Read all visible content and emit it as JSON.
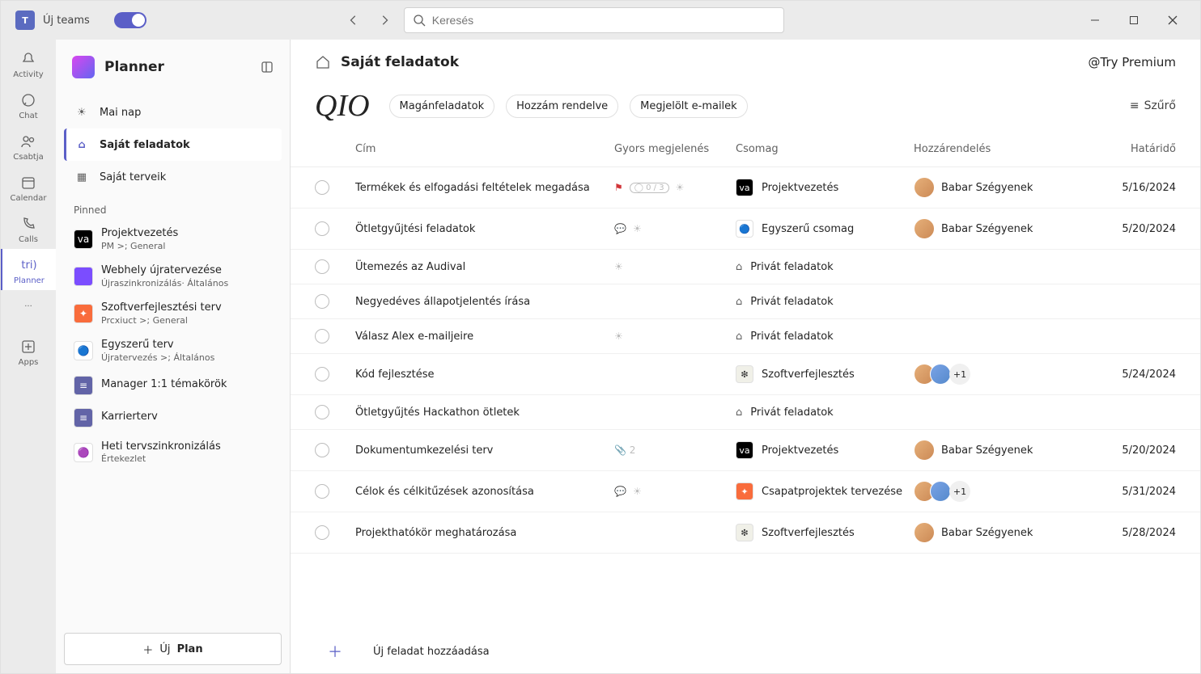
{
  "titlebar": {
    "app_label": "Új teams",
    "logo_initials": "T"
  },
  "search": {
    "placeholder": "Keresés"
  },
  "rail": {
    "activity": "Activity",
    "chat": "Chat",
    "csabtja": "Csabtja",
    "calendar": "Calendar",
    "calls": "Calls",
    "planner_short": "tri)",
    "planner": "Planner",
    "apps": "Apps"
  },
  "panel": {
    "title": "Planner",
    "nav": {
      "today": "Mai nap",
      "mytasks": "Saját feladatok",
      "myplans": "Saját terveik"
    },
    "pinned_label": "Pinned",
    "pinned": [
      {
        "title": "Projektvezetés",
        "sub": "PM >; General",
        "icon_bg": "#000",
        "icon_txt": "va"
      },
      {
        "title": "Webhely újratervezése",
        "sub": "Újraszinkronizálás·  Általános",
        "icon_bg": "#7b4dff",
        "icon_txt": ""
      },
      {
        "title": "Szoftverfejlesztési terv",
        "sub": "Prcxiuct >; General",
        "icon_bg": "#f96c3c",
        "icon_txt": "✦"
      },
      {
        "title": "Egyszerű terv",
        "sub": "Újratervezés >; Általános",
        "icon_bg": "#fff",
        "icon_txt": "🔵"
      },
      {
        "title": "Manager 1:1 témakörök",
        "sub": "",
        "icon_bg": "#6264a7",
        "icon_txt": "≡"
      },
      {
        "title": "Karrierterv",
        "sub": "",
        "icon_bg": "#6264a7",
        "icon_txt": "≡"
      },
      {
        "title": "Heti tervszinkronizálás",
        "sub": "Értekezlet",
        "icon_bg": "#fff",
        "icon_txt": "🟣"
      }
    ],
    "newplan": {
      "new": "Új",
      "plan": "Plan"
    }
  },
  "main": {
    "header_title": "Saját feladatok",
    "try_premium": "@Try Premium",
    "qio": "QIO",
    "tabs": {
      "private": "Magánfeladatok",
      "assigned": "Hozzám rendelve",
      "flagged": "Megjelölt e-mailek"
    },
    "filter": "Szűrő",
    "cols": {
      "title": "Cím",
      "quick": "Gyors megjelenés",
      "pkg": "Csomag",
      "assign": "Hozzárendelés",
      "due": "Határidő"
    },
    "private_label": "Privát feladatok",
    "rows": [
      {
        "title": "Termékek és elfogadási feltételek megadása",
        "quick_flag": true,
        "quick_progress": "0 / 3",
        "quick_sun": true,
        "pkg": {
          "type": "icon",
          "label": "Projektvezetés",
          "bg": "#000",
          "txt": "va"
        },
        "assign": {
          "names": "Babar Szégyenek",
          "multi": false
        },
        "due": "5/16/2024"
      },
      {
        "title": "Ötletgyűjtési feladatok",
        "quick_chat": true,
        "quick_sun": true,
        "pkg": {
          "type": "icon",
          "label": "Egyszerű csomag",
          "bg": "#fff",
          "txt": "🔵"
        },
        "assign": {
          "names": "Babar Szégyenek",
          "multi": false
        },
        "due": "5/20/2024"
      },
      {
        "title": "Ütemezés az Audival",
        "quick_sun": true,
        "pkg": {
          "type": "private"
        },
        "due": ""
      },
      {
        "title": "Negyedéves állapotjelentés írása",
        "pkg": {
          "type": "private"
        },
        "due": ""
      },
      {
        "title": "Válasz Alex e-mailjeire",
        "quick_sun": true,
        "pkg": {
          "type": "private"
        },
        "due": ""
      },
      {
        "title": "Kód fejlesztése",
        "pkg": {
          "type": "icon",
          "label": "Szoftverfejlesztés",
          "bg": "#f0f0e8",
          "txt": "❇"
        },
        "assign": {
          "multi": true,
          "extra": "+1"
        },
        "due": "5/24/2024"
      },
      {
        "title": "Ötletgyűjtés Hackathon ötletek",
        "pkg": {
          "type": "private"
        },
        "due": ""
      },
      {
        "title": "Dokumentumkezelési terv",
        "quick_attach": "2",
        "pkg": {
          "type": "icon",
          "label": "Projektvezetés",
          "bg": "#000",
          "txt": "va"
        },
        "assign": {
          "names": "Babar Szégyenek",
          "multi": false
        },
        "due": "5/20/2024"
      },
      {
        "title": "Célok és célkitűzések azonosítása",
        "quick_chat": true,
        "quick_sun": true,
        "pkg": {
          "type": "icon",
          "label": "Csapatprojektek tervezése",
          "bg": "#f96c3c",
          "txt": "✦"
        },
        "assign": {
          "multi": true,
          "extra": "+1"
        },
        "due": "5/31/2024"
      },
      {
        "title": "Projekthatókör meghatározása",
        "pkg": {
          "type": "icon",
          "label": "Szoftverfejlesztés",
          "bg": "#f0f0e8",
          "txt": "❇"
        },
        "assign": {
          "names": "Babar Szégyenek",
          "multi": false
        },
        "due": "5/28/2024"
      }
    ],
    "add_task": "Új feladat hozzáadása"
  }
}
